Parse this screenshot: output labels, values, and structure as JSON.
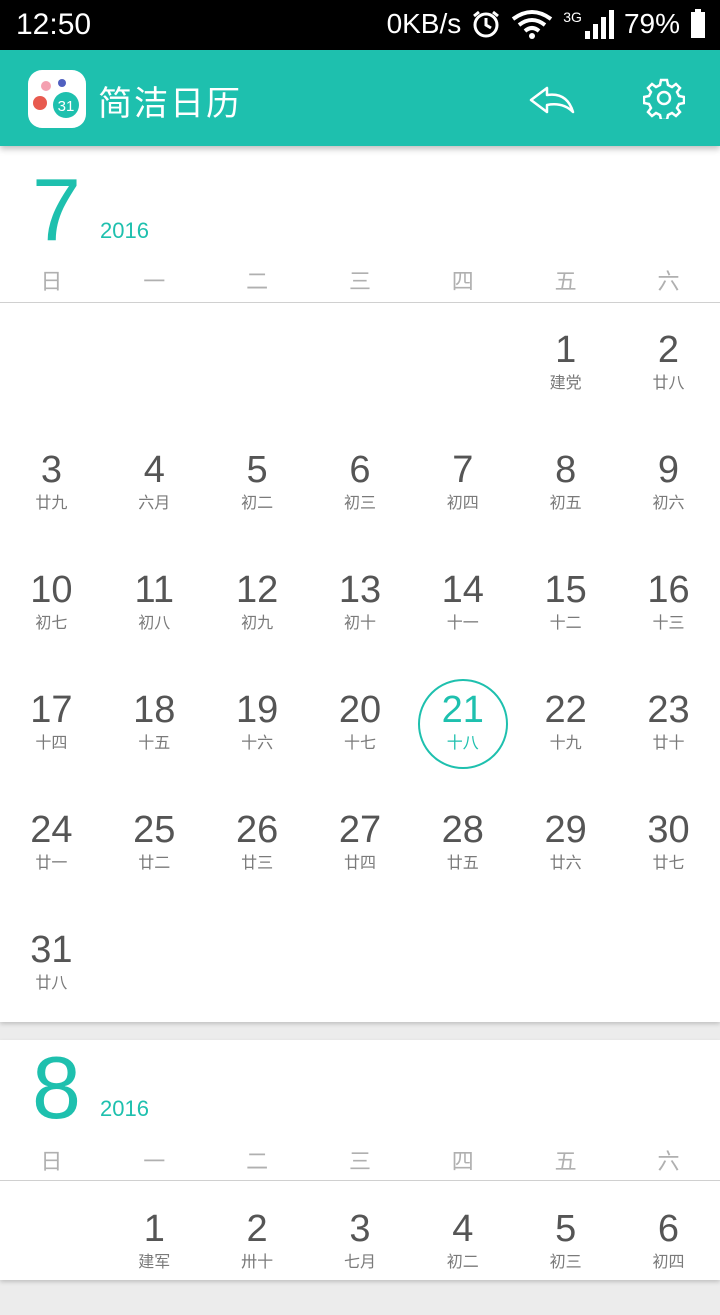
{
  "status_bar": {
    "time": "12:50",
    "net_speed": "0KB/s",
    "network": "3G",
    "battery": "79%"
  },
  "app_bar": {
    "logo_text": "31",
    "title": "简洁日历",
    "icons": [
      "undo-icon",
      "gear-icon"
    ]
  },
  "colors": {
    "accent": "#1ec0ae",
    "day_text": "#555555",
    "lunar_text": "#7a7a7a"
  },
  "weekdays": [
    "日",
    "一",
    "二",
    "三",
    "四",
    "五",
    "六"
  ],
  "months": [
    {
      "month": "7",
      "year": "2016",
      "weeks": [
        [
          {
            "d": "",
            "l": ""
          },
          {
            "d": "",
            "l": ""
          },
          {
            "d": "",
            "l": ""
          },
          {
            "d": "",
            "l": ""
          },
          {
            "d": "",
            "l": ""
          },
          {
            "d": "1",
            "l": "建党"
          },
          {
            "d": "2",
            "l": "廿八"
          }
        ],
        [
          {
            "d": "3",
            "l": "廿九"
          },
          {
            "d": "4",
            "l": "六月"
          },
          {
            "d": "5",
            "l": "初二"
          },
          {
            "d": "6",
            "l": "初三"
          },
          {
            "d": "7",
            "l": "初四"
          },
          {
            "d": "8",
            "l": "初五"
          },
          {
            "d": "9",
            "l": "初六"
          }
        ],
        [
          {
            "d": "10",
            "l": "初七"
          },
          {
            "d": "11",
            "l": "初八"
          },
          {
            "d": "12",
            "l": "初九"
          },
          {
            "d": "13",
            "l": "初十"
          },
          {
            "d": "14",
            "l": "十一"
          },
          {
            "d": "15",
            "l": "十二"
          },
          {
            "d": "16",
            "l": "十三"
          }
        ],
        [
          {
            "d": "17",
            "l": "十四"
          },
          {
            "d": "18",
            "l": "十五"
          },
          {
            "d": "19",
            "l": "十六"
          },
          {
            "d": "20",
            "l": "十七"
          },
          {
            "d": "21",
            "l": "十八",
            "today": true
          },
          {
            "d": "22",
            "l": "十九"
          },
          {
            "d": "23",
            "l": "廿十"
          }
        ],
        [
          {
            "d": "24",
            "l": "廿一"
          },
          {
            "d": "25",
            "l": "廿二"
          },
          {
            "d": "26",
            "l": "廿三"
          },
          {
            "d": "27",
            "l": "廿四"
          },
          {
            "d": "28",
            "l": "廿五"
          },
          {
            "d": "29",
            "l": "廿六"
          },
          {
            "d": "30",
            "l": "廿七"
          }
        ],
        [
          {
            "d": "31",
            "l": "廿八"
          },
          {
            "d": "",
            "l": ""
          },
          {
            "d": "",
            "l": ""
          },
          {
            "d": "",
            "l": ""
          },
          {
            "d": "",
            "l": ""
          },
          {
            "d": "",
            "l": ""
          },
          {
            "d": "",
            "l": ""
          }
        ]
      ]
    },
    {
      "month": "8",
      "year": "2016",
      "weeks": [
        [
          {
            "d": "",
            "l": ""
          },
          {
            "d": "1",
            "l": "建军"
          },
          {
            "d": "2",
            "l": "卅十"
          },
          {
            "d": "3",
            "l": "七月"
          },
          {
            "d": "4",
            "l": "初二"
          },
          {
            "d": "5",
            "l": "初三"
          },
          {
            "d": "6",
            "l": "初四"
          }
        ]
      ]
    }
  ]
}
